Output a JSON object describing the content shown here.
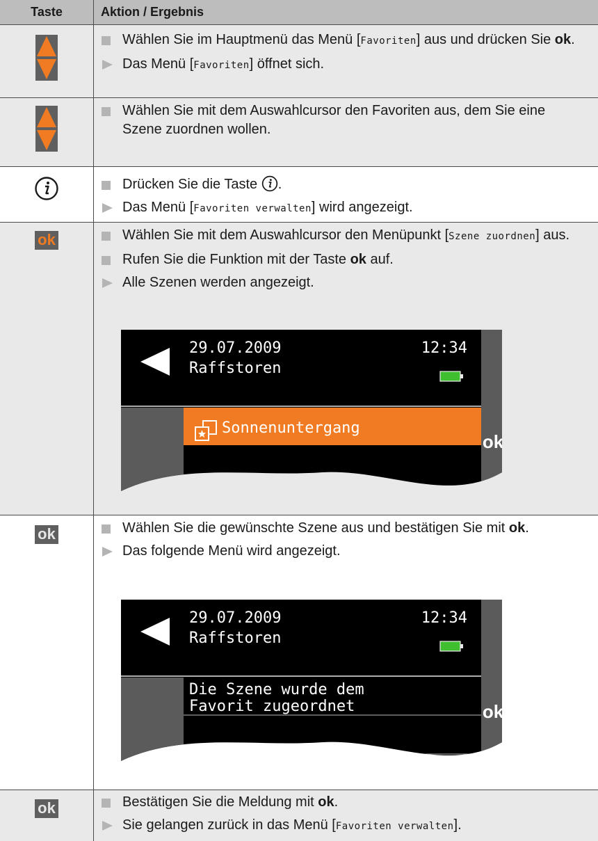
{
  "header": {
    "taste": "Taste",
    "aktion": "Aktion / Ergebnis"
  },
  "keys": {
    "ok_label": "ok",
    "icon_updown": "arrow-up-down-icon",
    "icon_info": "info-icon"
  },
  "rows": [
    {
      "key": "up-down",
      "items": [
        {
          "type": "action",
          "pre": "Wählen Sie im Hauptmenü das Menü [",
          "code": "Favoriten",
          "post": "] aus und drücken Sie ",
          "bold": "ok",
          "end": "."
        },
        {
          "type": "result",
          "pre": "Das Menü [",
          "code": "Favoriten",
          "post": "] öffnet sich."
        }
      ]
    },
    {
      "key": "up-down",
      "items": [
        {
          "type": "action",
          "text": "Wählen Sie mit dem Auswahlcursor den Favoriten aus, dem Sie eine Szene zuordnen wollen."
        }
      ]
    },
    {
      "key": "info",
      "items": [
        {
          "type": "action",
          "pre": "Drücken Sie die Taste ",
          "post": "."
        },
        {
          "type": "result",
          "pre": "Das Menü [",
          "code": "Favoriten verwalten",
          "post": "] wird angezeigt."
        }
      ]
    },
    {
      "key": "ok-orange",
      "items": [
        {
          "type": "action",
          "pre": "Wählen Sie mit dem Auswahlcursor den Menüpunkt [",
          "code": "Szene zuordnen",
          "post": "] aus."
        },
        {
          "type": "action",
          "pre": "Rufen Sie die Funktion mit der Taste ",
          "bold": "ok",
          "post": " auf."
        },
        {
          "type": "result",
          "text": "Alle Szenen werden angezeigt."
        }
      ],
      "screen": {
        "date": "29.07.2009",
        "time": "12:34",
        "device": "Raffstoren",
        "selected": "Sonnenuntergang",
        "ok": "ok"
      }
    },
    {
      "key": "ok-grey",
      "items": [
        {
          "type": "action",
          "pre": "Wählen Sie die gewünschte Szene aus und bestätigen Sie mit ",
          "bold": "ok",
          "post": "."
        },
        {
          "type": "result",
          "text": "Das folgende Menü wird angezeigt."
        }
      ],
      "screen": {
        "date": "29.07.2009",
        "time": "12:34",
        "device": "Raffstoren",
        "message_line1": "Die Szene wurde dem",
        "message_line2": "Favorit zugeordnet",
        "ok": "ok"
      }
    },
    {
      "key": "ok-grey",
      "items": [
        {
          "type": "action",
          "pre": "Bestätigen Sie die Meldung mit ",
          "bold": "ok",
          "post": "."
        },
        {
          "type": "result",
          "pre": "Sie gelangen zurück in das Menü [",
          "code": "Favoriten verwalten",
          "post": "]."
        }
      ]
    }
  ],
  "colors": {
    "orange": "#f07b22",
    "header_bg": "#bdbdbd",
    "row_grey": "#e9e9e9",
    "screen_bg": "#000000",
    "screen_side": "#5b5b5b",
    "battery": "#3fbf2f"
  }
}
